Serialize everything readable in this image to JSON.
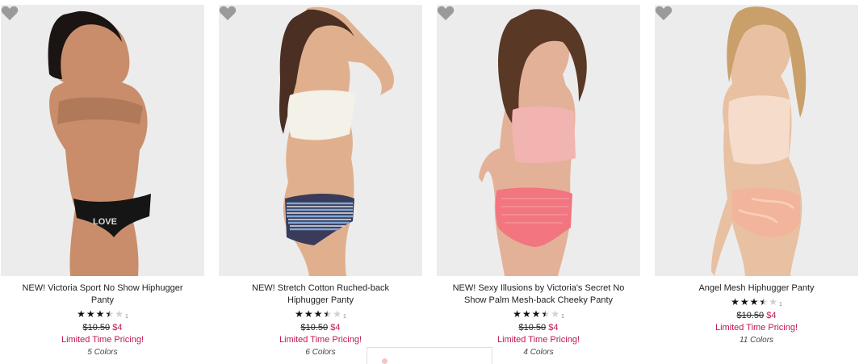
{
  "products": [
    {
      "name": "NEW! Victoria Sport No Show Hiphugger Panty",
      "stars": [
        1,
        1,
        1,
        0.5,
        0
      ],
      "rating_count": "1",
      "old_price": "$10.50",
      "new_price": "$4",
      "promo": "Limited Time Pricing!",
      "colors": "5 Colors",
      "favorite_icon": "heart-icon"
    },
    {
      "name": "NEW! Stretch Cotton Ruched-back Hiphugger Panty",
      "stars": [
        1,
        1,
        1,
        0.5,
        0
      ],
      "rating_count": "1",
      "old_price": "$10.50",
      "new_price": "$4",
      "promo": "Limited Time Pricing!",
      "colors": "6 Colors",
      "favorite_icon": "heart-icon"
    },
    {
      "name": "NEW! Sexy Illusions by Victoria's Secret No Show Palm Mesh-back Cheeky Panty",
      "stars": [
        1,
        1,
        1,
        0.5,
        0
      ],
      "rating_count": "1",
      "old_price": "$10.50",
      "new_price": "$4",
      "promo": "Limited Time Pricing!",
      "colors": "4 Colors",
      "favorite_icon": "heart-icon"
    },
    {
      "name": "Angel Mesh Hiphugger Panty",
      "stars": [
        1,
        1,
        1,
        0.5,
        0
      ],
      "rating_count": "1",
      "old_price": "$10.50",
      "new_price": "$4",
      "promo": "Limited Time Pricing!",
      "colors": "11 Colors",
      "favorite_icon": "heart-icon"
    }
  ],
  "colors": {
    "sale": "#c4174a",
    "photo_bg": "#eeeeee",
    "heart": "#9a9a9a"
  }
}
